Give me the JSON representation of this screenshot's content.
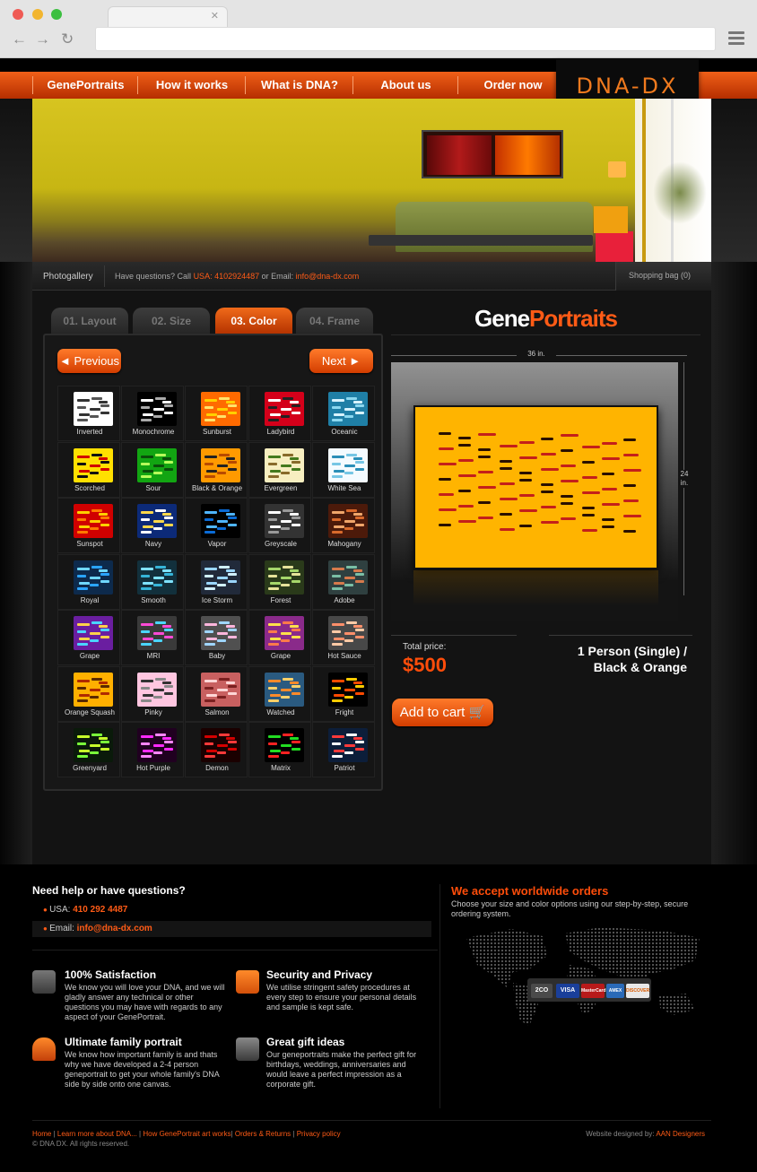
{
  "nav": {
    "items": [
      "GenePortraits",
      "How it works",
      "What is DNA?",
      "About us",
      "Order now"
    ],
    "logo": "DNA-DX"
  },
  "infobar": {
    "photogallery": "Photogallery",
    "questions_prefix": "Have questions? Call ",
    "usa_phone": "USA: 4102924487",
    "email_prefix": " or Email: ",
    "email": "info@dna-dx.com",
    "shopping_bag": "Shopping bag (0)"
  },
  "steps": [
    {
      "label": "01. Layout"
    },
    {
      "label": "02. Size"
    },
    {
      "label": "03. Color"
    },
    {
      "label": "04. Frame"
    }
  ],
  "buttons": {
    "previous": "◄ Previous",
    "next": "Next ►",
    "add_to_cart": "Add to cart 🛒"
  },
  "colors": [
    {
      "name": "Inverted",
      "bg": "#ffffff",
      "bars": [
        "#333333",
        "#555555"
      ]
    },
    {
      "name": "Monochrome",
      "bg": "#000000",
      "bars": [
        "#ffffff",
        "#aaaaaa"
      ]
    },
    {
      "name": "Sunburst",
      "bg": "#ff6a00",
      "bars": [
        "#ffd000",
        "#ffe36a"
      ]
    },
    {
      "name": "Ladybird",
      "bg": "#d4001a",
      "bars": [
        "#ffffff",
        "#222222"
      ]
    },
    {
      "name": "Oceanic",
      "bg": "#1f7fa6",
      "bars": [
        "#d8f3ff",
        "#8cd8f0"
      ]
    },
    {
      "name": "Scorched",
      "bg": "#ffe000",
      "bars": [
        "#d10000",
        "#111111"
      ]
    },
    {
      "name": "Sour",
      "bg": "#12a512",
      "bars": [
        "#0a4d0a",
        "#b6ff5b"
      ]
    },
    {
      "name": "Black & Orange",
      "bg": "#ff9a00",
      "bars": [
        "#222222",
        "#b84a00"
      ]
    },
    {
      "name": "Evergreen",
      "bg": "#f7eec0",
      "bars": [
        "#447a1d",
        "#886a2a"
      ]
    },
    {
      "name": "White Sea",
      "bg": "#f4fbff",
      "bars": [
        "#2b8fb8",
        "#76c6e5"
      ]
    },
    {
      "name": "Sunspot",
      "bg": "#d00000",
      "bars": [
        "#ffd000",
        "#ff7a00"
      ]
    },
    {
      "name": "Navy",
      "bg": "#0c2a78",
      "bars": [
        "#ffd84a",
        "#ffffff"
      ]
    },
    {
      "name": "Vapor",
      "bg": "#000000",
      "bars": [
        "#4fb5ff",
        "#0a6bd6"
      ]
    },
    {
      "name": "Greyscale",
      "bg": "#333333",
      "bars": [
        "#ffffff",
        "#999999"
      ]
    },
    {
      "name": "Mahogany",
      "bg": "#4c1a0a",
      "bars": [
        "#f0a66a",
        "#d86a2c"
      ]
    },
    {
      "name": "Royal",
      "bg": "#0d2a4c",
      "bars": [
        "#6fd7ff",
        "#2aa4ff"
      ]
    },
    {
      "name": "Smooth",
      "bg": "#12303c",
      "bars": [
        "#7fe2ff",
        "#36b5d8"
      ]
    },
    {
      "name": "Ice Storm",
      "bg": "#212a3a",
      "bars": [
        "#9ad6ff",
        "#d0f0ff"
      ]
    },
    {
      "name": "Forest",
      "bg": "#2a3a1a",
      "bars": [
        "#a5d66a",
        "#e6e29a"
      ]
    },
    {
      "name": "Adobe",
      "bg": "#2f4040",
      "bars": [
        "#d67a4c",
        "#7abfa6"
      ]
    },
    {
      "name": "Grape",
      "bg": "#6a1ea0",
      "bars": [
        "#ffd14a",
        "#4ad6ff"
      ]
    },
    {
      "name": "MRI",
      "bg": "#3a3a3a",
      "bars": [
        "#ff4ad6",
        "#4ad6ff"
      ]
    },
    {
      "name": "Baby",
      "bg": "#505050",
      "bars": [
        "#ffb6dc",
        "#9fd6ff"
      ]
    },
    {
      "name": "Grape",
      "bg": "#8a2a8a",
      "bars": [
        "#ffe04a",
        "#ff7a4a"
      ]
    },
    {
      "name": "Hot Sauce",
      "bg": "#484848",
      "bars": [
        "#ff8f6a",
        "#ffcaa6"
      ]
    },
    {
      "name": "Orange Squash",
      "bg": "#ffb000",
      "bars": [
        "#b02a00",
        "#5a2a00"
      ]
    },
    {
      "name": "Pinky",
      "bg": "#ffc6e0",
      "bars": [
        "#333333",
        "#888888"
      ]
    },
    {
      "name": "Salmon",
      "bg": "#c86060",
      "bars": [
        "#ffd6d6",
        "#7a2020"
      ]
    },
    {
      "name": "Watched",
      "bg": "#2a5a80",
      "bars": [
        "#ff8a2a",
        "#ffd16a"
      ]
    },
    {
      "name": "Fright",
      "bg": "#000000",
      "bars": [
        "#ff4a00",
        "#ffcc00"
      ]
    },
    {
      "name": "Greenyard",
      "bg": "#0a1a0a",
      "bars": [
        "#c6ff2a",
        "#7aff3a"
      ]
    },
    {
      "name": "Hot Purple",
      "bg": "#200020",
      "bars": [
        "#ff2aff",
        "#ff86ff"
      ]
    },
    {
      "name": "Demon",
      "bg": "#1a0000",
      "bars": [
        "#d40000",
        "#ff3a3a"
      ]
    },
    {
      "name": "Matrix",
      "bg": "#000000",
      "bars": [
        "#22dd22",
        "#ff2222"
      ]
    },
    {
      "name": "Patriot",
      "bg": "#0c1e3a",
      "bars": [
        "#ff3a3a",
        "#ffffff"
      ]
    }
  ],
  "product": {
    "title_part1": "Gene",
    "title_part2": "Portraits",
    "width_label": "36 in.",
    "height_label_1": "24",
    "height_label_2": "in.",
    "total_label": "Total price:",
    "price": "$500",
    "config_line1": "1 Person (Single) /",
    "config_line2": "Black & Orange"
  },
  "footer": {
    "help_title": "Need help or have questions?",
    "usa_label": "USA: ",
    "usa_value": "410 292 4487",
    "email_label": "Email: ",
    "email_value": "info@dna-dx.com",
    "worldwide_title": "We accept worldwide orders",
    "worldwide_text": "Choose your size and color options using our step-by-step, secure ordering system.",
    "features": [
      {
        "title": "100% Satisfaction",
        "text": "We know you will love your DNA, and we will gladly answer any technical or other questions you may have with regards to any aspect of your GenePortrait."
      },
      {
        "title": "Security and Privacy",
        "text": "We utilise stringent safety procedures at every step to ensure your personal details and sample is kept safe."
      },
      {
        "title": "Ultimate family portrait",
        "text": "We know how important family is and thats why we have developed a 2-4 person geneportrait to get your whole family's DNA side by side onto one canvas."
      },
      {
        "title": "Great gift ideas",
        "text": "Our geneportraits make the perfect gift for birthdays, weddings, anniversaries and would leave a perfect impression as a corporate gift."
      }
    ],
    "cards": [
      "2CO",
      "VISA",
      "MasterCard",
      "AMEX",
      "DISCOVER"
    ],
    "links": [
      "Home",
      "Learn more about DNA...",
      "How GenePortrait art works",
      "Orders & Returns",
      "Privacy policy"
    ],
    "copyright": "© DNA DX. All rights reserved.",
    "designed_prefix": "Website designed by: ",
    "designer": "AAN Designers"
  },
  "accent_color": "#ff5b16"
}
